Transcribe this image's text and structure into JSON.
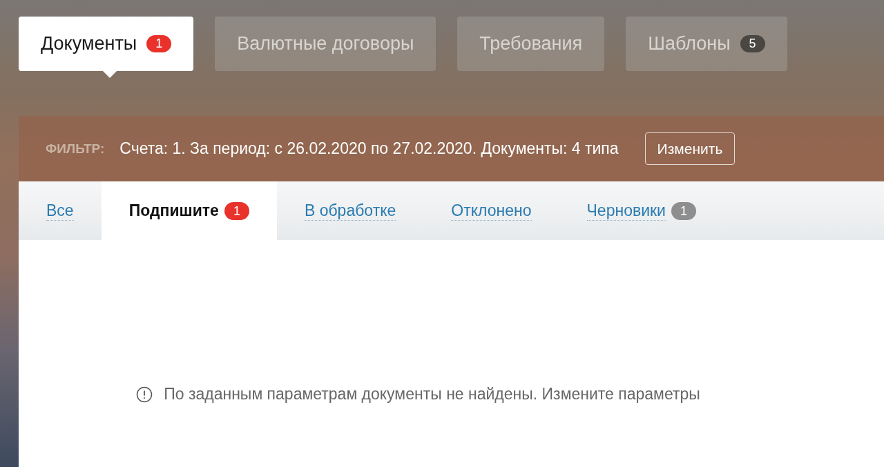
{
  "main_tabs": [
    {
      "label": "Документы",
      "selected": true,
      "badge": {
        "text": "1",
        "color": "#e8322b"
      }
    },
    {
      "label": "Валютные договоры",
      "selected": false
    },
    {
      "label": "Требования",
      "selected": false
    },
    {
      "label": "Шаблоны",
      "selected": false,
      "badge": {
        "text": "5",
        "color": "#4a4642"
      }
    }
  ],
  "filter": {
    "label": "ФИЛЬТР:",
    "summary": "Счета: 1. За период: с 26.02.2020 по 27.02.2020. Документы: 4 типа",
    "button": "Изменить"
  },
  "sub_tabs": [
    {
      "label": "Все",
      "selected": false
    },
    {
      "label": "Подпишите",
      "selected": true,
      "badge": {
        "text": "1",
        "color": "#e8322b"
      }
    },
    {
      "label": "В обработке",
      "selected": false
    },
    {
      "label": "Отклонено",
      "selected": false
    },
    {
      "label": "Черновики",
      "selected": false,
      "badge": {
        "text": "1",
        "color": "#8e8e8e"
      }
    }
  ],
  "empty_message": "По заданным параметрам документы не найдены. Измените параметры"
}
